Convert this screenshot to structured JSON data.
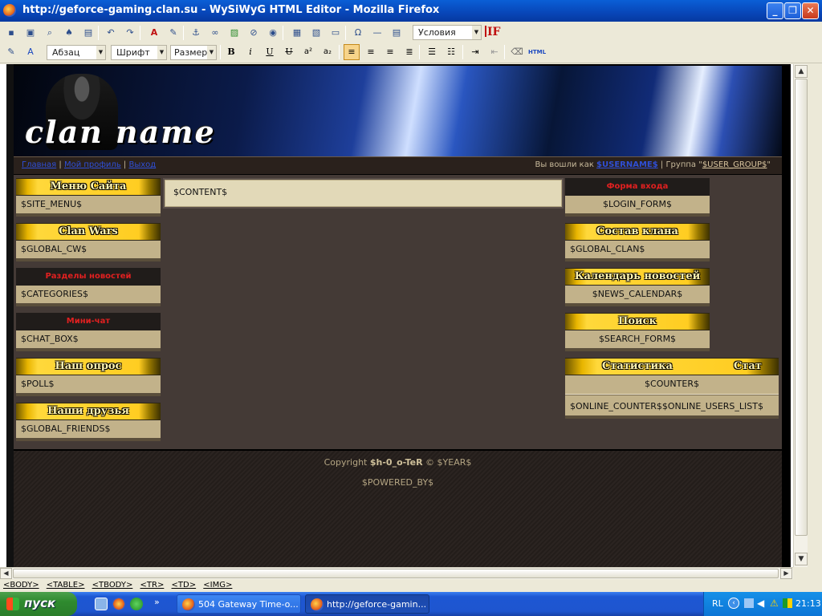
{
  "window": {
    "title": "http://geforce-gaming.clan.su - WySiWyG HTML Editor - Mozilla Firefox"
  },
  "toolbar1": {
    "conditions_combo": "Условия",
    "if_label": "IF"
  },
  "toolbar2": {
    "paragraph_combo": "Абзац",
    "font_combo": "Шрифт",
    "size_combo": "Размер",
    "bold": "B",
    "italic": "i",
    "underline": "U",
    "strike": "U",
    "superscript": "a²",
    "subscript": "a₂",
    "html": "HTML"
  },
  "page": {
    "logo_text": "clan name",
    "nav": {
      "link1": "Главная",
      "sep": "|",
      "link2": "Мой профиль",
      "link3": "Выход"
    },
    "user": {
      "prefix": "Вы вошли как",
      "username": "$USERNAME$",
      "group_label": "| Группа \"",
      "group": "$USER_GROUP$",
      "suffix": "\""
    },
    "left_blocks": [
      {
        "title": "Меню Сайта",
        "body": "$SITE_MENU$"
      },
      {
        "title": "Clan Wars",
        "body": "$GLOBAL_CW$"
      },
      {
        "title": "Разделы новостей",
        "body": "$CATEGORIES$"
      },
      {
        "title": "Мини-чат",
        "body": "$CHAT_BOX$"
      },
      {
        "title": "Наш опрос",
        "body": "$POLL$"
      },
      {
        "title": "Наши друзья",
        "body": "$GLOBAL_FRIENDS$"
      }
    ],
    "content": "$CONTENT$",
    "right_blocks": [
      {
        "title": "Форма входа",
        "body": "$LOGIN_FORM$"
      },
      {
        "title": "Состав клана",
        "body": "$GLOBAL_CLAN$"
      },
      {
        "title": "Календарь новостей",
        "body": "$NEWS_CALENDAR$"
      },
      {
        "title": "Поиск",
        "body": "$SEARCH_FORM$"
      },
      {
        "title": "Статистика",
        "title_repeat": "Стат",
        "body": "$COUNTER$",
        "body2": "$ONLINE_COUNTER$$ONLINE_USERS_LIST$"
      }
    ],
    "footer": {
      "copyright_prefix": "Copyright",
      "author": "$h-0_o-TeR",
      "copyright_suffix": "© $YEAR$",
      "powered": "$POWERED_BY$"
    }
  },
  "statusbar": {
    "tags": [
      "<BODY>",
      "<TABLE>",
      "<TBODY>",
      "<TR>",
      "<TD>",
      "<IMG>"
    ]
  },
  "taskbar": {
    "start": "пуск",
    "task1": "504 Gateway Time-o...",
    "task2": "http://geforce-gamin...",
    "lang": "RL",
    "clock": "21:13"
  },
  "colors": {
    "accent_red": "#e02020",
    "gold": "#ffd83b",
    "body_tan": "#c2b28a",
    "page_bg": "#443a36"
  }
}
